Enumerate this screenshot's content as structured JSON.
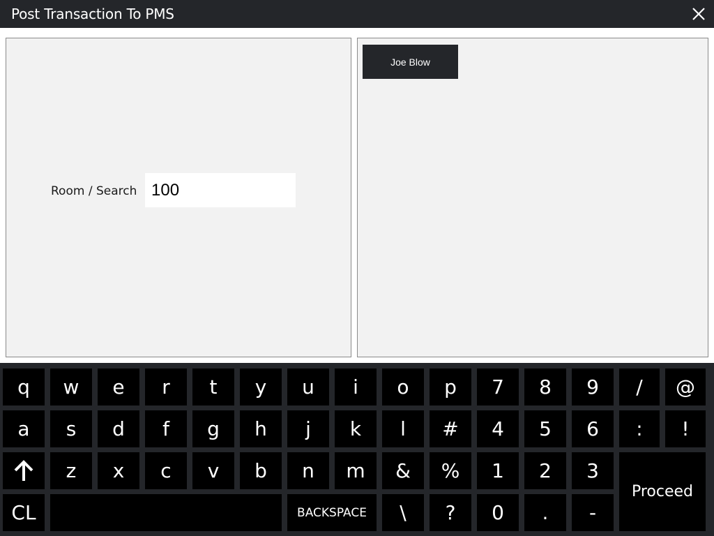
{
  "window": {
    "title": "Post Transaction To PMS",
    "close_icon": "close-icon"
  },
  "search": {
    "label": "Room / Search",
    "value": "100"
  },
  "results": {
    "guests": [
      {
        "label": "Joe Blow"
      }
    ]
  },
  "keyboard": {
    "row1": [
      "q",
      "w",
      "e",
      "r",
      "t",
      "y",
      "u",
      "i",
      "o",
      "p",
      "7",
      "8",
      "9",
      "/",
      "@"
    ],
    "row2": [
      "a",
      "s",
      "d",
      "f",
      "g",
      "h",
      "j",
      "k",
      "l",
      "#",
      "4",
      "5",
      "6",
      ":",
      "!"
    ],
    "row3": [
      "z",
      "x",
      "c",
      "v",
      "b",
      "n",
      "m",
      "&",
      "%",
      "1",
      "2",
      "3"
    ],
    "row4": [
      "\\",
      "?",
      "0",
      ".",
      "-"
    ],
    "shift_icon": "arrow-up-icon",
    "clear_label": "CL",
    "backspace_label": "BACKSPACE",
    "proceed_label": "Proceed"
  },
  "colors": {
    "titlebar": "#24262a",
    "key_background": "#000000",
    "panel_background": "#f2f2f2"
  }
}
